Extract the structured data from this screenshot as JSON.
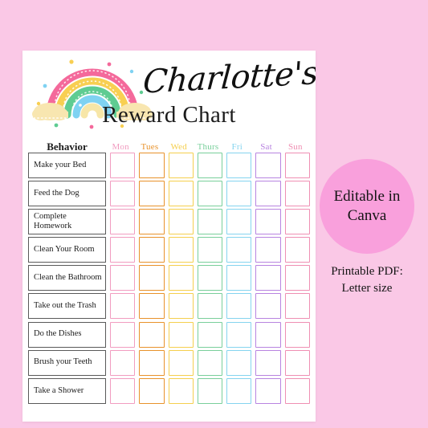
{
  "background_color": "#fac8e6",
  "page": {
    "background_color": "#ffffff",
    "title_script": "Charlotte's",
    "title_serif": "Reward Chart",
    "artwork": "rainbow-with-clouds-and-confetti"
  },
  "table": {
    "behavior_header": "Behavior",
    "days": [
      {
        "label": "Mon",
        "color": "#f19cc0"
      },
      {
        "label": "Tues",
        "color": "#e8922b"
      },
      {
        "label": "Wed",
        "color": "#f5cf4e"
      },
      {
        "label": "Thurs",
        "color": "#79cf9b"
      },
      {
        "label": "Fri",
        "color": "#85d4ef"
      },
      {
        "label": "Sat",
        "color": "#b884e0"
      },
      {
        "label": "Sun",
        "color": "#ef8fb3"
      }
    ],
    "behaviors": [
      "Make your Bed",
      "Feed the Dog",
      "Complete Homework",
      "Clean Your Room",
      "Clean the Bathroom",
      "Take out the Trash",
      "Do the Dishes",
      "Brush your Teeth",
      "Take a Shower"
    ]
  },
  "sidebar": {
    "badge_text": "Editable in Canva",
    "badge_color": "#f9a0dc",
    "note_line1": "Printable PDF:",
    "note_line2": "Letter size"
  }
}
